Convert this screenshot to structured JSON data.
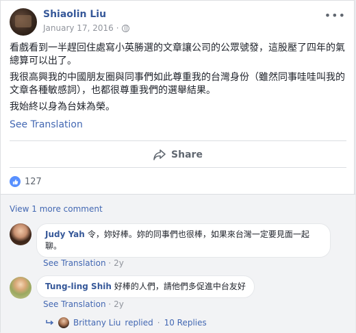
{
  "post": {
    "author": "Shiaolin Liu",
    "date": "January 17, 2016",
    "date_sep": "·",
    "more_icon": "more-dots-icon",
    "paragraphs": [
      "看戲看到一半趕回住處寫小英勝選的文章讓公司的公眾號發，這股壓了四年的氣總算可以出了。",
      "我很高興我的中國朋友圈與同事們如此尊重我的台灣身份（雖然同事哇哇叫我的文章各種敏感詞），也都很尊重我們的選舉結果。",
      "我始終以身為台妹為榮。"
    ],
    "see_translation": "See Translation",
    "share_label": "Share",
    "reaction_count": "127"
  },
  "comments": {
    "view_more": "View 1 more comment",
    "items": [
      {
        "name": "Judy Yah",
        "text": "令，妳好棒。妳的同事們也很棒，如果來台灣一定要見面一起聊。",
        "see_translation": "See Translation",
        "sep": "·",
        "age": "2y"
      },
      {
        "name": "Tung-ling Shih",
        "text": "好棒的人們，請他們多促進中台友好",
        "see_translation": "See Translation",
        "sep": "·",
        "age": "2y"
      }
    ],
    "reply": {
      "name": "Brittany Liu",
      "action": "replied",
      "sep": "·",
      "count": "10 Replies"
    }
  },
  "colors": {
    "link": "#4267b2",
    "name": "#365899",
    "muted": "#90949c",
    "like_badge": "#5890ff"
  }
}
